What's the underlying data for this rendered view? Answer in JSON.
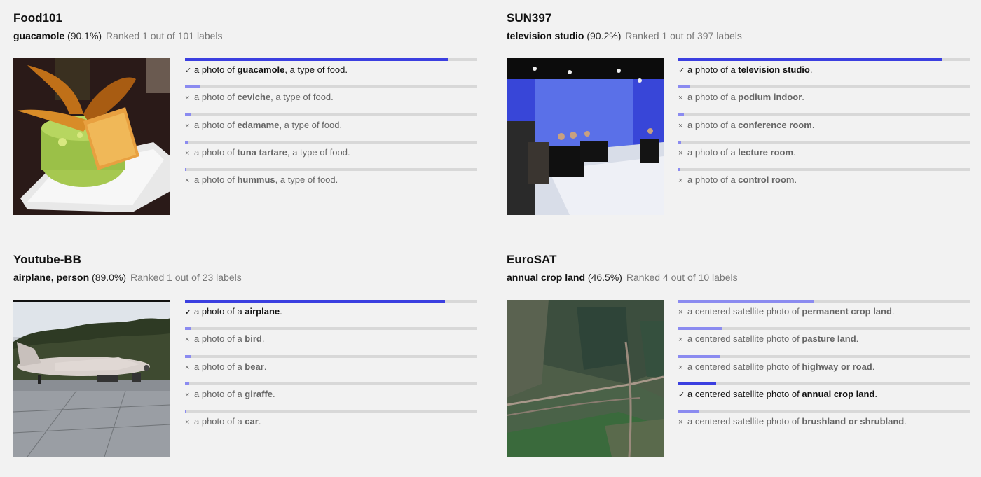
{
  "cards": [
    {
      "title": "Food101",
      "label": "guacamole",
      "pct": "(90.1%)",
      "rank": "Ranked 1 out of 101 labels",
      "image": "guacamole dish photo",
      "predictions": [
        {
          "mark": "✓",
          "pre": "a photo of ",
          "key": "guacamole",
          "post": ", a type of food.",
          "score": 0.9,
          "correct": true
        },
        {
          "mark": "×",
          "pre": "a photo of ",
          "key": "ceviche",
          "post": ", a type of food.",
          "score": 0.05,
          "correct": false
        },
        {
          "mark": "×",
          "pre": "a photo of ",
          "key": "edamame",
          "post": ", a type of food.",
          "score": 0.02,
          "correct": false
        },
        {
          "mark": "×",
          "pre": "a photo of ",
          "key": "tuna tartare",
          "post": ", a type of food.",
          "score": 0.01,
          "correct": false
        },
        {
          "mark": "×",
          "pre": "a photo of ",
          "key": "hummus",
          "post": ", a type of food.",
          "score": 0.005,
          "correct": false
        }
      ]
    },
    {
      "title": "SUN397",
      "label": "television studio",
      "pct": "(90.2%)",
      "rank": "Ranked 1 out of 397 labels",
      "image": "television studio photo",
      "predictions": [
        {
          "mark": "✓",
          "pre": "a photo of a ",
          "key": "television studio",
          "post": ".",
          "score": 0.902,
          "correct": true
        },
        {
          "mark": "×",
          "pre": "a photo of a ",
          "key": "podium indoor",
          "post": ".",
          "score": 0.04,
          "correct": false
        },
        {
          "mark": "×",
          "pre": "a photo of a ",
          "key": "conference room",
          "post": ".",
          "score": 0.02,
          "correct": false
        },
        {
          "mark": "×",
          "pre": "a photo of a ",
          "key": "lecture room",
          "post": ".",
          "score": 0.01,
          "correct": false
        },
        {
          "mark": "×",
          "pre": "a photo of a ",
          "key": "control room",
          "post": ".",
          "score": 0.005,
          "correct": false
        }
      ]
    },
    {
      "title": "Youtube-BB",
      "label": "airplane, person",
      "pct": "(89.0%)",
      "rank": "Ranked 1 out of 23 labels",
      "image": "airplane on tarmac photo",
      "predictions": [
        {
          "mark": "✓",
          "pre": "a photo of a ",
          "key": "airplane",
          "post": ".",
          "score": 0.89,
          "correct": true
        },
        {
          "mark": "×",
          "pre": "a photo of a ",
          "key": "bird",
          "post": ".",
          "score": 0.02,
          "correct": false
        },
        {
          "mark": "×",
          "pre": "a photo of a ",
          "key": "bear",
          "post": ".",
          "score": 0.02,
          "correct": false
        },
        {
          "mark": "×",
          "pre": "a photo of a ",
          "key": "giraffe",
          "post": ".",
          "score": 0.015,
          "correct": false
        },
        {
          "mark": "×",
          "pre": "a photo of a ",
          "key": "car",
          "post": ".",
          "score": 0.005,
          "correct": false
        }
      ]
    },
    {
      "title": "EuroSAT",
      "label": "annual crop land",
      "pct": "(46.5%)",
      "rank": "Ranked 4 out of 10 labels",
      "image": "satellite farmland photo",
      "predictions": [
        {
          "mark": "×",
          "pre": "a centered satellite photo of ",
          "key": "permanent crop land",
          "post": ".",
          "score": 0.465,
          "correct": false
        },
        {
          "mark": "×",
          "pre": "a centered satellite photo of ",
          "key": "pasture land",
          "post": ".",
          "score": 0.15,
          "correct": false
        },
        {
          "mark": "×",
          "pre": "a centered satellite photo of ",
          "key": "highway or road",
          "post": ".",
          "score": 0.145,
          "correct": false
        },
        {
          "mark": "✓",
          "pre": "a centered satellite photo of ",
          "key": "annual crop land",
          "post": ".",
          "score": 0.13,
          "correct": true
        },
        {
          "mark": "×",
          "pre": "a centered satellite photo of ",
          "key": "brushland or shrubland",
          "post": ".",
          "score": 0.07,
          "correct": false
        }
      ]
    }
  ]
}
